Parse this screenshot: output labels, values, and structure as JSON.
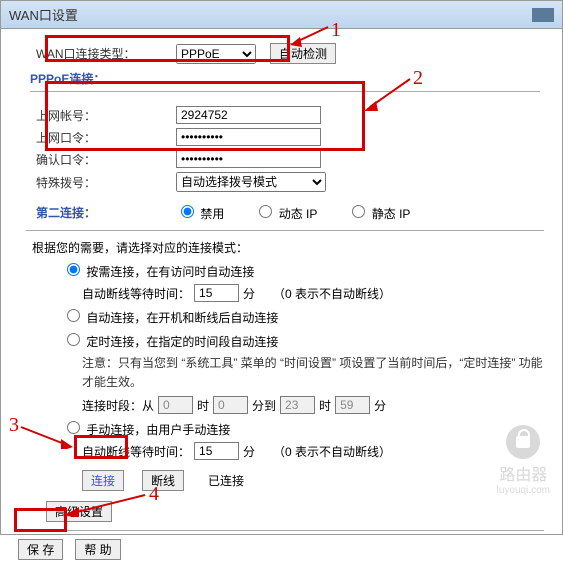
{
  "title": "WAN口设置",
  "wan_type_label": "WAN口连接类型：",
  "wan_type_value": "PPPoE",
  "auto_detect": "自动检测",
  "pppoe_title": "PPPoE连接：",
  "account_label": "上网帐号：",
  "account_value": "2924752",
  "password_label": "上网口令：",
  "password_value": "••••••••••",
  "confirm_label": "确认口令：",
  "confirm_value": "••••••••••",
  "special_dial_label": "特殊拨号：",
  "special_dial_value": "自动选择拨号模式",
  "second_conn_label": "第二连接：",
  "radio_disable": "禁用",
  "radio_dyn": "动态 IP",
  "radio_static": "静态 IP",
  "mode_prompt": "根据您的需要，请选择对应的连接模式：",
  "mode_ondemand": "按需连接，在有访问时自动连接",
  "idle_label": "自动断线等待时间：",
  "idle_value": "15",
  "idle_unit": "分",
  "idle_note": "（0 表示不自动断线）",
  "mode_auto": "自动连接，在开机和断线后自动连接",
  "mode_timed": "定时连接，在指定的时间段自动连接",
  "timed_note": "注意：只有当您到 “系统工具” 菜单的 “时间设置” 项设置了当前时间后，“定时连接” 功能才能生效。",
  "period_label": "连接时段：从",
  "period_from_h": "0",
  "period_h": "时",
  "period_from_m": "0",
  "period_m": "分到",
  "period_to_h": "23",
  "period_to_m": "59",
  "period_m2": "分",
  "mode_manual": "手动连接，由用户手动连接",
  "idle2_value": "15",
  "btn_connect": "连接",
  "btn_disconnect": "断线",
  "status_connected": "已连接",
  "btn_advanced": "高级设置",
  "btn_save": "保 存",
  "btn_help": "帮 助",
  "anno1": "1",
  "anno2": "2",
  "anno3": "3",
  "anno4": "4",
  "wm_text": "路由器",
  "wm_url": "luyouqi.com"
}
